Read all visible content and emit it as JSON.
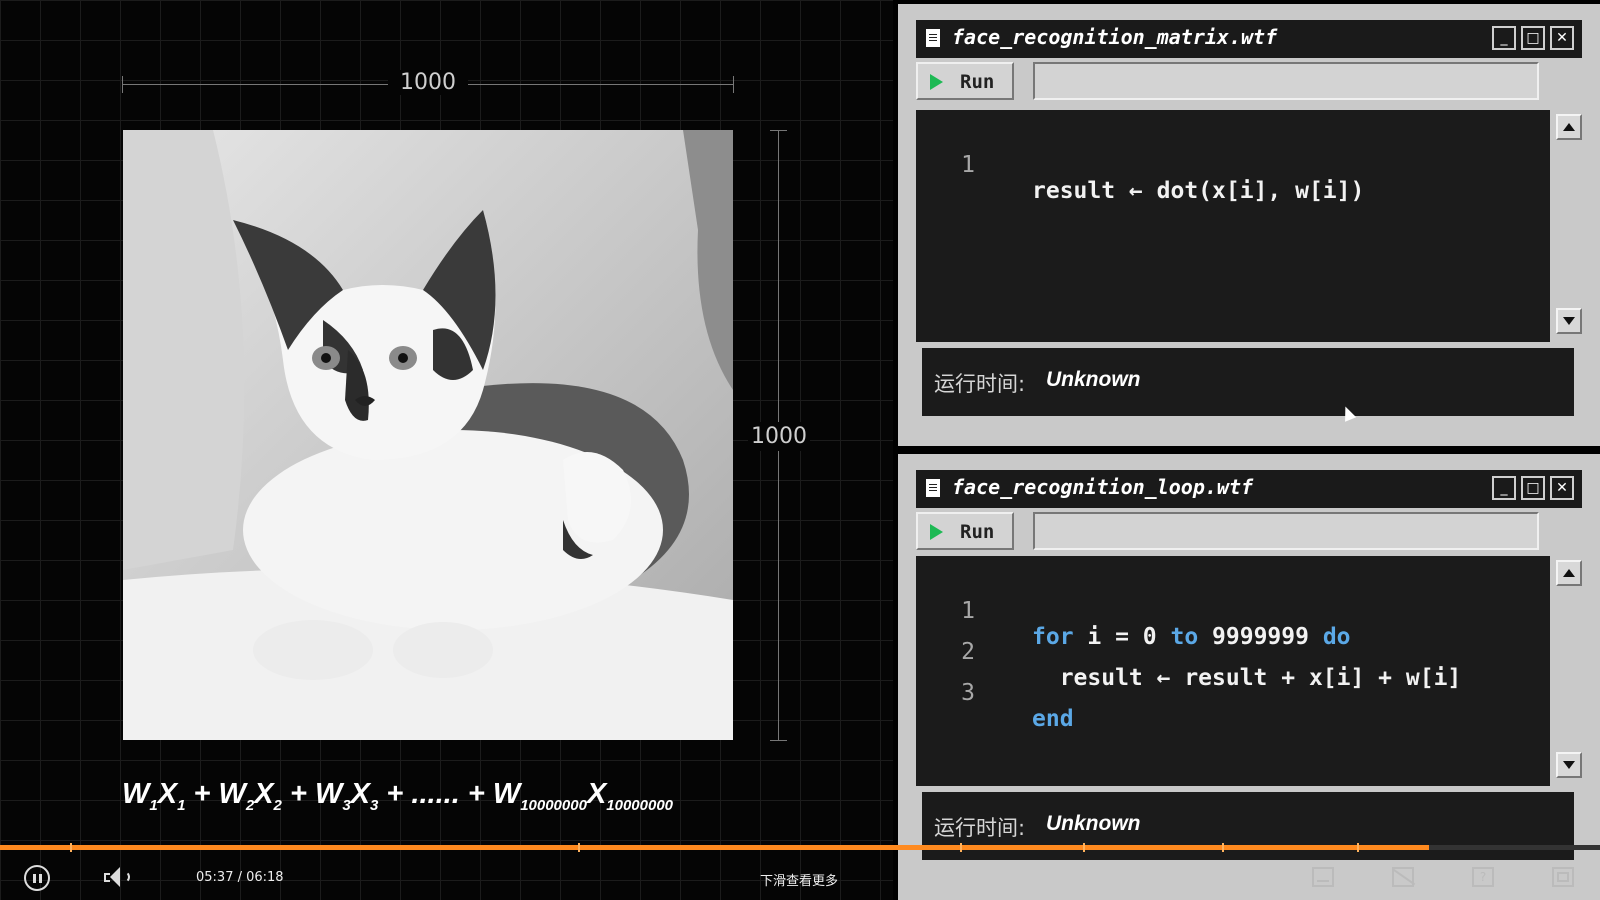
{
  "left_panel": {
    "width_label": "1000",
    "height_label": "1000",
    "image_description": "cat-thumbs-up-photo",
    "formula": {
      "terms": [
        {
          "w": "W",
          "w_sub": "1",
          "x": "X",
          "x_sub": "1"
        },
        {
          "w": "W",
          "w_sub": "2",
          "x": "X",
          "x_sub": "2"
        },
        {
          "w": "W",
          "w_sub": "3",
          "x": "X",
          "x_sub": "3"
        }
      ],
      "plus": "+",
      "ellipsis": "......",
      "last": {
        "w": "W",
        "w_sub": "10000000",
        "x": "X",
        "x_sub": "10000000"
      }
    }
  },
  "window_matrix": {
    "title": "face_recognition_matrix.wtf",
    "run_label": "Run",
    "lines": [
      {
        "num": "1",
        "code": "result ← dot(x[i], w[i])"
      }
    ],
    "status_label": "运行时间:",
    "status_value": "Unknown"
  },
  "window_loop": {
    "title": "face_recognition_loop.wtf",
    "run_label": "Run",
    "line1": {
      "num": "1",
      "kw1": "for",
      "mid1": " i = 0 ",
      "kw2": "to",
      "mid2": " 9999999 ",
      "kw3": "do"
    },
    "line2": {
      "num": "2",
      "code": "  result ← result + x[i] + w[i]"
    },
    "line3": {
      "num": "3",
      "kw": "end"
    },
    "status_label": "运行时间:",
    "status_value": "Unknown"
  },
  "window_buttons": {
    "minimize": "_",
    "maximize": "□",
    "close": "✕"
  },
  "player": {
    "time": "05:37 / 06:18",
    "more_text": "下滑查看更多",
    "progress": 0.893,
    "progress_color": "#ff8a1f",
    "chapter_marks": [
      0.044,
      0.361,
      0.6,
      0.677,
      0.764,
      0.848
    ],
    "help_label": "?"
  },
  "colors": {
    "keyword": "#5ba8e6",
    "run_icon": "#1db954"
  }
}
